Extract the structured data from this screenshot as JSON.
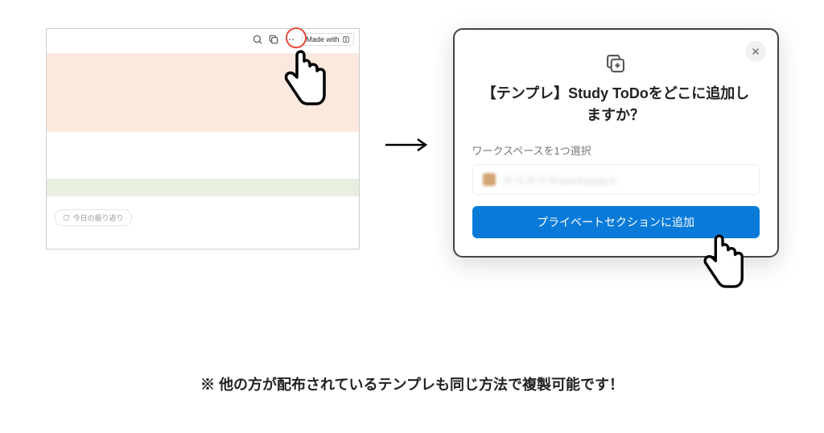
{
  "left": {
    "made_with_label": "Made with",
    "today_chip": "今日の振り返り"
  },
  "dialog": {
    "title": "【テンプレ】Study ToDoをどこに追加しますか？",
    "subtitle": "ワークスペースを1つ選択",
    "workspace_name_blurred": "たらすけのworkspace",
    "add_button": "プライベートセクションに追加"
  },
  "footer": "※ 他の方が配布されているテンプレも同じ方法で複製可能です！"
}
